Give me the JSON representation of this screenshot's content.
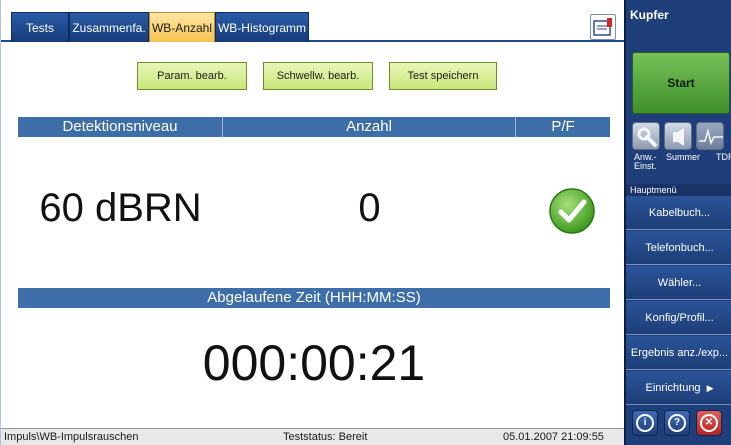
{
  "tabs": [
    {
      "label": "Tests",
      "active": false
    },
    {
      "label": "Zusammenfa.",
      "active": false
    },
    {
      "label": "WB-Anzahl",
      "active": true
    },
    {
      "label": "WB-Histogramm",
      "active": false
    }
  ],
  "toolbar": {
    "param_label": "Param. bearb.",
    "threshold_label": "Schwellw. bearb.",
    "save_label": "Test speichern"
  },
  "results_table": {
    "headers": [
      "Detektionsniveau",
      "Anzahl",
      "P/F"
    ],
    "row": {
      "level": "60 dBRN",
      "count": "0",
      "pf": "pass"
    }
  },
  "elapsed": {
    "header": "Abgelaufene Zeit (HHH:MM:SS)",
    "value": "000:00:21"
  },
  "status_bar": {
    "path": "Impuls\\WB-Impulsrauschen",
    "test_status": "Teststatus: Bereit",
    "datetime": "05.01.2007 21:09:55"
  },
  "side_panel": {
    "title": "Kupfer",
    "start_label": "Start",
    "tools": [
      {
        "label": "Anw.- Einst.",
        "icon": "wrench-icon"
      },
      {
        "label": "Summer",
        "icon": "speaker-icon"
      },
      {
        "label": "TDR",
        "icon": "waveform-icon"
      }
    ],
    "menu_header": "Hauptmenü",
    "menu_items": [
      "Kabelbuch...",
      "Telefonbuch...",
      "Wähler...",
      "Konfig/Profil...",
      "Ergebnis anz./exp...",
      "Einrichtung"
    ],
    "bottom_buttons": [
      {
        "symbol": "i",
        "icon": "info-icon"
      },
      {
        "symbol": "?",
        "icon": "help-icon"
      },
      {
        "symbol": "✕",
        "icon": "close-icon"
      }
    ]
  },
  "colors": {
    "header_blue": "#3d6ea8",
    "tab_active": "#f4c250",
    "button_green": "#c9e77a",
    "pass_green": "#5bb52e",
    "side_panel": "#1f3f7a"
  }
}
